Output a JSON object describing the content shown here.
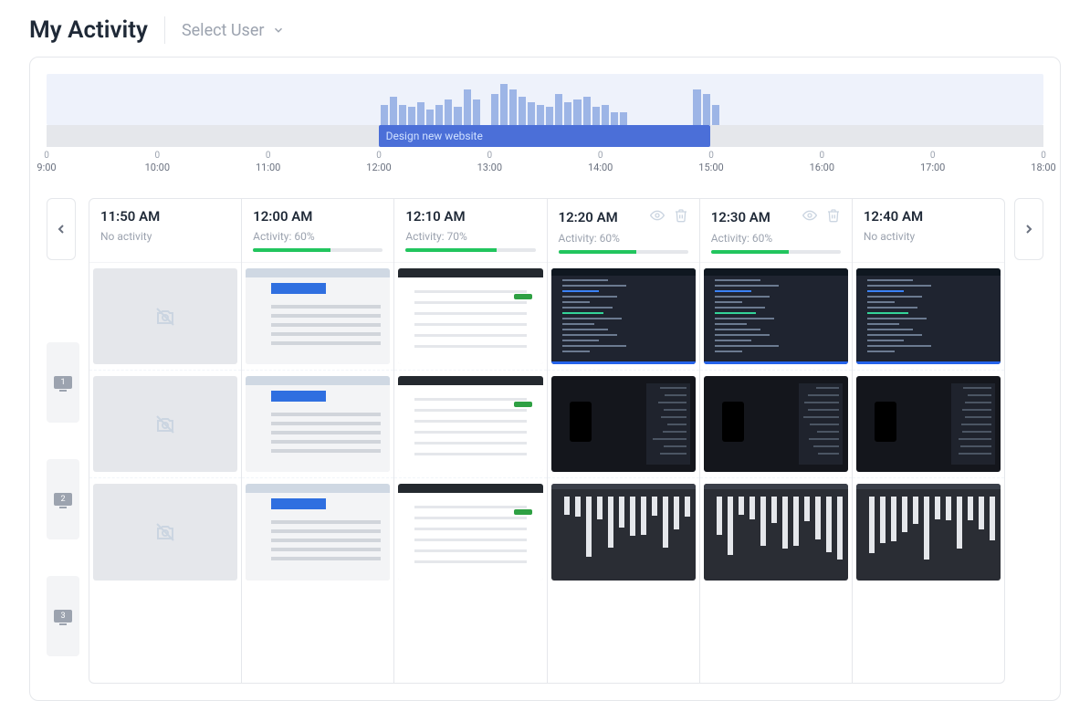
{
  "header": {
    "title": "My Activity",
    "select_user_label": "Select User"
  },
  "timeline": {
    "task_label": "Design new website",
    "task_start_pct": 33.3,
    "task_width_pct": 33.3,
    "labels": [
      "9:00",
      "10:00",
      "11:00",
      "12:00",
      "13:00",
      "14:00",
      "15:00",
      "16:00",
      "17:00",
      "18:00"
    ],
    "bars_pct": [
      0,
      0,
      0,
      0,
      0,
      0,
      0,
      0,
      0,
      0,
      0,
      0,
      0,
      0,
      0,
      0,
      0,
      0,
      0,
      0,
      0,
      0,
      0,
      0,
      0,
      0,
      0,
      0,
      0,
      0,
      0,
      0,
      0,
      0,
      0,
      0,
      40,
      55,
      40,
      35,
      45,
      30,
      40,
      50,
      35,
      70,
      50,
      0,
      60,
      80,
      70,
      55,
      45,
      40,
      35,
      60,
      45,
      50,
      55,
      35,
      40,
      25,
      25,
      0,
      0,
      0,
      0,
      0,
      0,
      0,
      70,
      60,
      40,
      0,
      0,
      0,
      0,
      0,
      0,
      0,
      0,
      0,
      0,
      0,
      0,
      0,
      0,
      0,
      0,
      0,
      0,
      0,
      0,
      0,
      0,
      0,
      0,
      0,
      0,
      0,
      0,
      0,
      0,
      0,
      0,
      0,
      0,
      0
    ]
  },
  "columns": [
    {
      "time": "11:50 AM",
      "activity_label": "No activity",
      "activity_pct": null,
      "show_icons": false,
      "thumbs": [
        "empty",
        "empty",
        "empty"
      ]
    },
    {
      "time": "12:00 AM",
      "activity_label": "Activity: 60%",
      "activity_pct": 60,
      "show_icons": false,
      "thumbs": [
        "light",
        "light",
        "light"
      ]
    },
    {
      "time": "12:10 AM",
      "activity_label": "Activity: 70%",
      "activity_pct": 70,
      "show_icons": false,
      "thumbs": [
        "github",
        "github",
        "github"
      ]
    },
    {
      "time": "12:20 AM",
      "activity_label": "Activity: 60%",
      "activity_pct": 60,
      "show_icons": true,
      "thumbs": [
        "code",
        "editor2",
        "tracks"
      ]
    },
    {
      "time": "12:30 AM",
      "activity_label": "Activity: 60%",
      "activity_pct": 60,
      "show_icons": true,
      "thumbs": [
        "code",
        "editor2",
        "tracks"
      ]
    },
    {
      "time": "12:40 AM",
      "activity_label": "No activity",
      "activity_pct": null,
      "show_icons": false,
      "thumbs": [
        "code",
        "editor2",
        "tracks"
      ]
    }
  ],
  "screen_rails": [
    "1",
    "2",
    "3"
  ]
}
